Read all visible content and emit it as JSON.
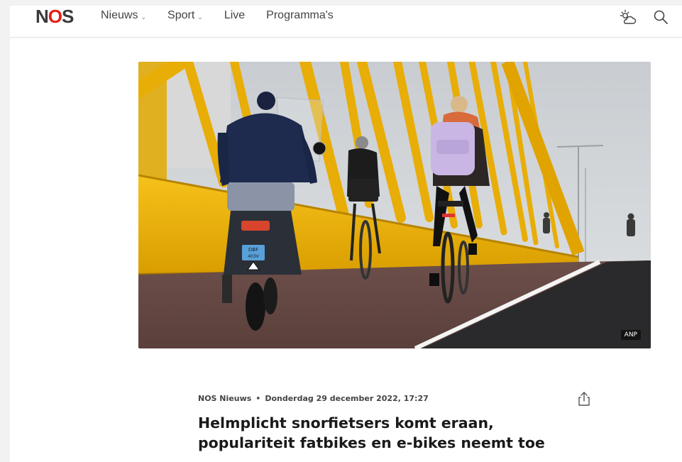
{
  "header": {
    "logo": {
      "prefix": "N",
      "o": "O",
      "suffix": "S"
    },
    "nav": [
      {
        "label": "Nieuws",
        "dropdown": true
      },
      {
        "label": "Sport",
        "dropdown": true
      },
      {
        "label": "Live",
        "dropdown": false
      },
      {
        "label": "Programma's",
        "dropdown": false
      }
    ],
    "icons": [
      "weather-icon",
      "search-icon"
    ]
  },
  "hero": {
    "credit": "ANP",
    "plate_text_1": "DBF",
    "plate_text_2": "403V"
  },
  "article": {
    "source": "NOS Nieuws",
    "separator": "•",
    "date": "Donderdag 29 december 2022, 17:27",
    "headline_line1": "Helmplicht snorfietsers komt eraan,",
    "headline_line2": "populariteit fatbikes en e-bikes neemt toe"
  },
  "colors": {
    "brand_red": "#e61e14",
    "bridge_yellow": "#f0b400"
  }
}
